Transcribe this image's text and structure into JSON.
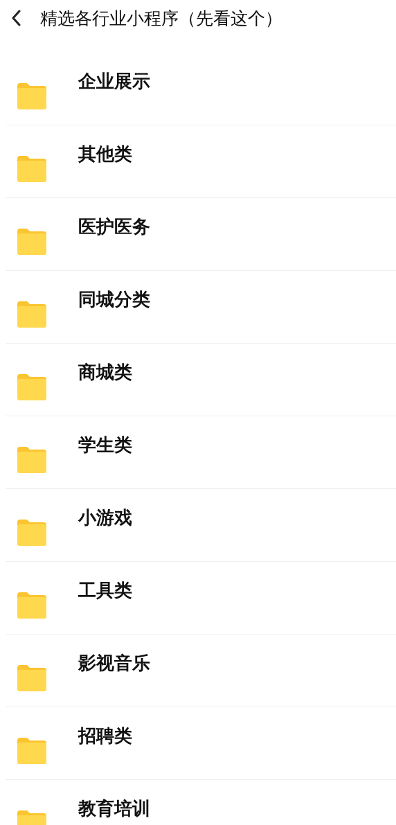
{
  "header": {
    "title": "精选各行业小程序（先看这个）"
  },
  "folders": [
    {
      "name": "企业展示"
    },
    {
      "name": "其他类"
    },
    {
      "name": "医护医务"
    },
    {
      "name": "同城分类"
    },
    {
      "name": "商城类"
    },
    {
      "name": "学生类"
    },
    {
      "name": "小游戏"
    },
    {
      "name": "工具类"
    },
    {
      "name": "影视音乐"
    },
    {
      "name": "招聘类"
    },
    {
      "name": "教育培训"
    }
  ]
}
